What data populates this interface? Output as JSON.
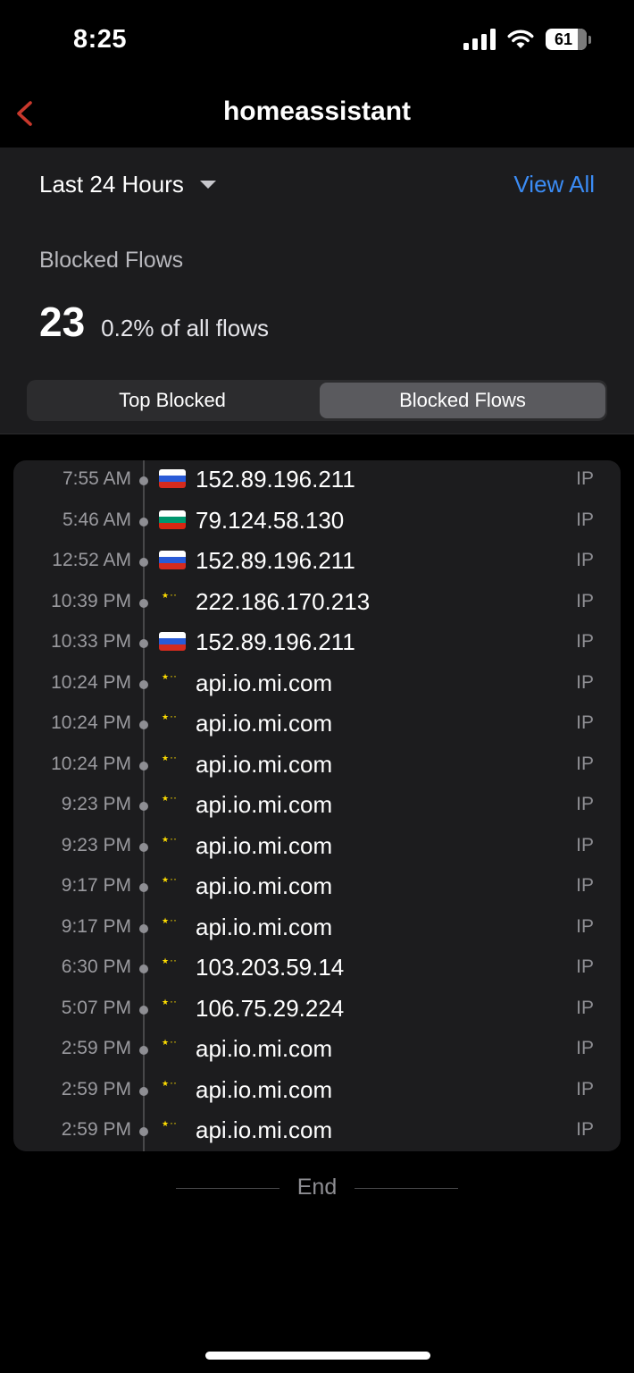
{
  "status_bar": {
    "time": "8:25",
    "battery": "61"
  },
  "nav": {
    "title": "homeassistant"
  },
  "summary": {
    "range_label": "Last 24 Hours",
    "view_all": "View All",
    "section_label": "Blocked Flows",
    "count": "23",
    "percent": "0.2% of all flows"
  },
  "tabs": {
    "top_blocked": "Top Blocked",
    "blocked_flows": "Blocked Flows",
    "selected": "Blocked Flows"
  },
  "flows": [
    {
      "time": "7:55 AM",
      "flag": "ru",
      "destination": "152.89.196.211",
      "type": "IP"
    },
    {
      "time": "5:46 AM",
      "flag": "bg",
      "destination": "79.124.58.130",
      "type": "IP"
    },
    {
      "time": "12:52 AM",
      "flag": "ru",
      "destination": "152.89.196.211",
      "type": "IP"
    },
    {
      "time": "10:39 PM",
      "flag": "cn",
      "destination": "222.186.170.213",
      "type": "IP"
    },
    {
      "time": "10:33 PM",
      "flag": "ru",
      "destination": "152.89.196.211",
      "type": "IP"
    },
    {
      "time": "10:24 PM",
      "flag": "cn",
      "destination": "api.io.mi.com",
      "type": "IP"
    },
    {
      "time": "10:24 PM",
      "flag": "cn",
      "destination": "api.io.mi.com",
      "type": "IP"
    },
    {
      "time": "10:24 PM",
      "flag": "cn",
      "destination": "api.io.mi.com",
      "type": "IP"
    },
    {
      "time": "9:23 PM",
      "flag": "cn",
      "destination": "api.io.mi.com",
      "type": "IP"
    },
    {
      "time": "9:23 PM",
      "flag": "cn",
      "destination": "api.io.mi.com",
      "type": "IP"
    },
    {
      "time": "9:17 PM",
      "flag": "cn",
      "destination": "api.io.mi.com",
      "type": "IP"
    },
    {
      "time": "9:17 PM",
      "flag": "cn",
      "destination": "api.io.mi.com",
      "type": "IP"
    },
    {
      "time": "6:30 PM",
      "flag": "cn",
      "destination": "103.203.59.14",
      "type": "IP"
    },
    {
      "time": "5:07 PM",
      "flag": "cn",
      "destination": "106.75.29.224",
      "type": "IP"
    },
    {
      "time": "2:59 PM",
      "flag": "cn",
      "destination": "api.io.mi.com",
      "type": "IP"
    },
    {
      "time": "2:59 PM",
      "flag": "cn",
      "destination": "api.io.mi.com",
      "type": "IP"
    },
    {
      "time": "2:59 PM",
      "flag": "cn",
      "destination": "api.io.mi.com",
      "type": "IP"
    }
  ],
  "end_label": "End",
  "colors": {
    "accent_blue": "#3b8cf5",
    "back_red": "#c8382c",
    "panel": "#1c1c1e"
  },
  "icons": {
    "back": "chevron-left-icon",
    "dropdown": "caret-down-icon",
    "signal": "cellular-signal-icon",
    "wifi": "wifi-icon",
    "battery": "battery-icon"
  }
}
